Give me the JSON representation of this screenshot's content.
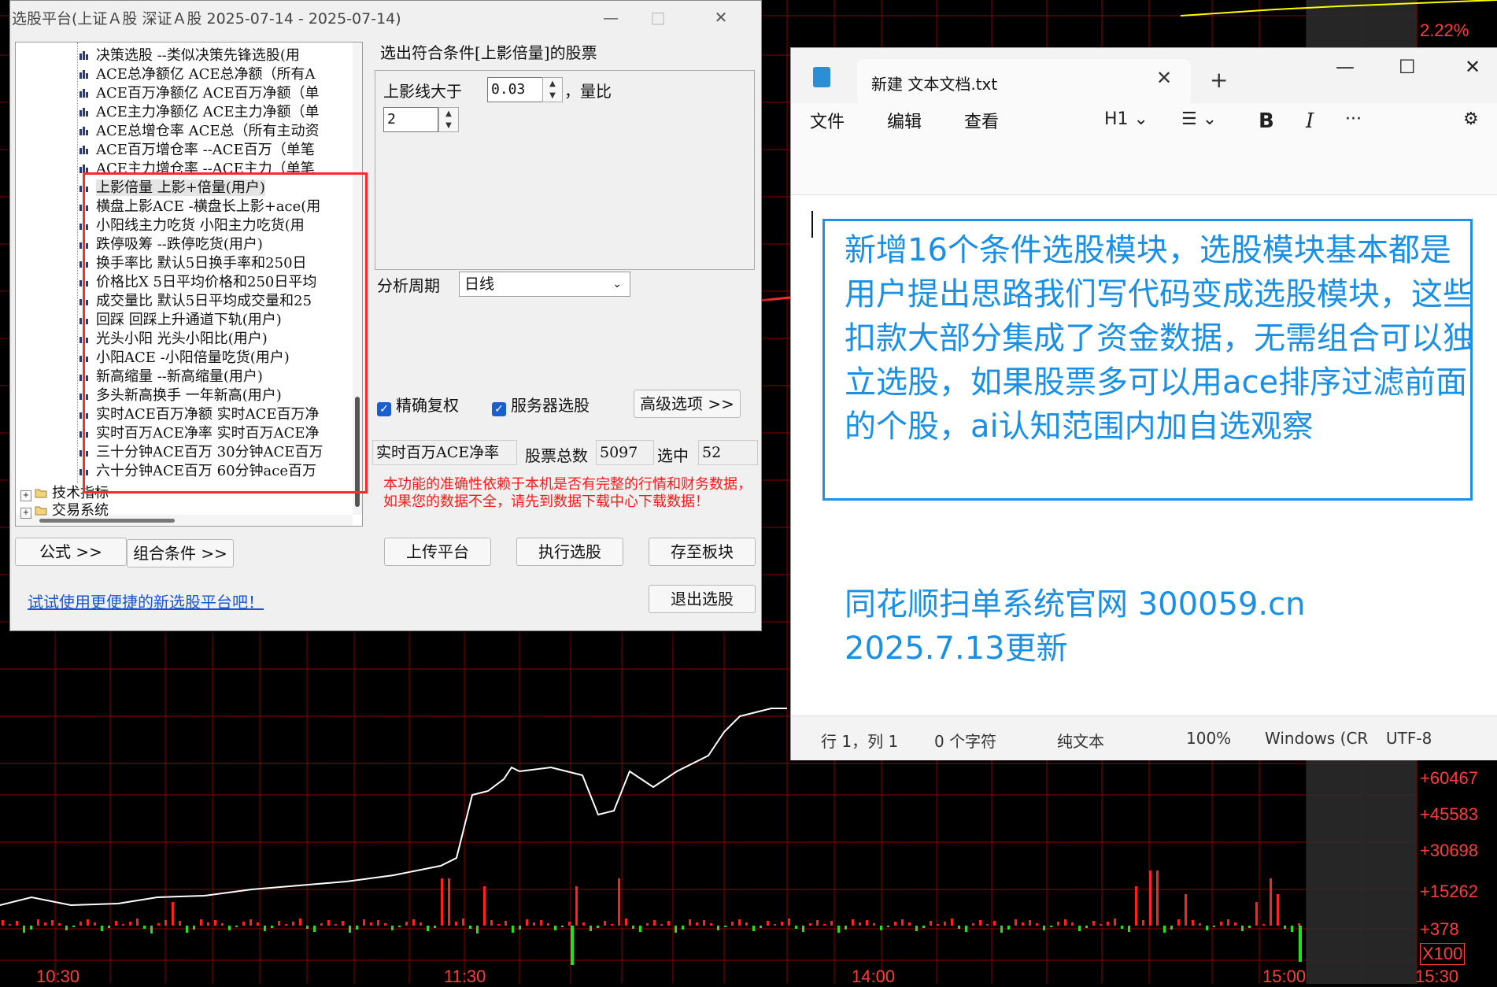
{
  "background_chart": {
    "price_pct_label": "2.22%",
    "volume_ticks": [
      "+60467",
      "+45583",
      "+30698",
      "+15262",
      "+378"
    ],
    "volume_multiplier": "X100",
    "time_labels": [
      "10:30",
      "11:30",
      "14:00",
      "15:00",
      "15:30"
    ],
    "colors": {
      "grid": "#8b0000",
      "price_line": "#ffffff",
      "avg_line": "#ffff00",
      "up_bar": "#ff2020",
      "down_bar": "#20e020"
    }
  },
  "picker": {
    "title": "选股平台(上证Ａ股 深证Ａ股   2025-07-14 - 2025-07-14)",
    "minimize": "—",
    "maximize": "□",
    "close": "✕",
    "tree_items": [
      "决策选股 --类似决策先锋选股(用",
      "ACE总净额亿  ACE总净额（所有A",
      "ACE百万净额亿 ACE百万净额（单",
      "ACE主力净额亿 ACE主力净额（单",
      "ACE总增仓率 ACE总（所有主动资",
      "ACE百万增仓率 --ACE百万（单笔",
      "ACE主力增仓率 --ACE主力（单笔",
      "上影倍量 上影+倍量(用户)",
      "横盘上影ACE -横盘长上影+ace(用",
      "小阳线主力吃货 小阳主力吃货(用",
      "跌停吸筹 --跌停吃货(用户)",
      "换手率比 默认5日换手率和250日",
      "价格比X 5日平均价格和250日平均",
      "成交量比 默认5日平均成交量和25",
      "回踩 回踩上升通道下轨(用户)",
      "光头小阳 光头小阳比(用户)",
      "小阳ACE -小阳倍量吃货(用户)",
      "新高缩量 --新高缩量(用户)",
      "多头新高换手 一年新高(用户)",
      "实时ACE百万净额 实时ACE百万净",
      "实时百万ACE净率 实时百万ACE净",
      "三十分钟ACE百万 30分钟ACE百万",
      "六十分钟ACE百万 60分钟ace百万"
    ],
    "tree_folders": [
      "技术指标",
      "交易系统"
    ],
    "result_heading": "选出符合条件[上影倍量]的股票",
    "param1_label": "上影线大于",
    "param1_value": "0.03",
    "param1_suffix": "，量比",
    "param2_value": "2",
    "period_label": "分析周期",
    "period_value": "日线",
    "check_fq": "精确复权",
    "check_server": "服务器选股",
    "btn_advanced": "高级选项 >>",
    "field_indicator": "实时百万ACE净率",
    "total_label": "股票总数",
    "total_value": "5097",
    "selected_label": "选中",
    "selected_value": "52",
    "warning": "本功能的准确性依赖于本机是否有完整的行情和财务数据，如果您的数据不全，请先到数据下载中心下载数据！",
    "btn_formula": "公式 >>",
    "btn_combo": "组合条件 >>",
    "btn_upload": "上传平台",
    "btn_run": "执行选股",
    "btn_save": "存至板块",
    "btn_exit": "退出选股",
    "link": "试试使用更便捷的新选股平台吧！"
  },
  "notepad": {
    "tab_title": "新建 文本文档.txt",
    "tab_close": "✕",
    "new_tab": "+",
    "minimize": "—",
    "maximize": "☐",
    "close": "✕",
    "menu": [
      "文件",
      "编辑",
      "查看"
    ],
    "heading_tool": "H1 ⌄",
    "list_tool": "☰ ⌄",
    "bold": "B",
    "italic": "I",
    "more": "···",
    "settings": "⚙",
    "boxed_text": "新增16个条件选股模块，选股模块基本都是用户提出思路我们写代码变成选股模块，这些扣款大部分集成了资金数据，无需组合可以独立选股，如果股票多可以用ace排序过滤前面的个股，ai认知范围内加自选观察",
    "footer_text": "同花顺扫单系统官网 300059.cn 2025.7.13更新",
    "status": [
      "行 1，列 1",
      "0 个字符",
      "纯文本",
      "100%",
      "Windows (CR",
      "UTF-8"
    ]
  }
}
